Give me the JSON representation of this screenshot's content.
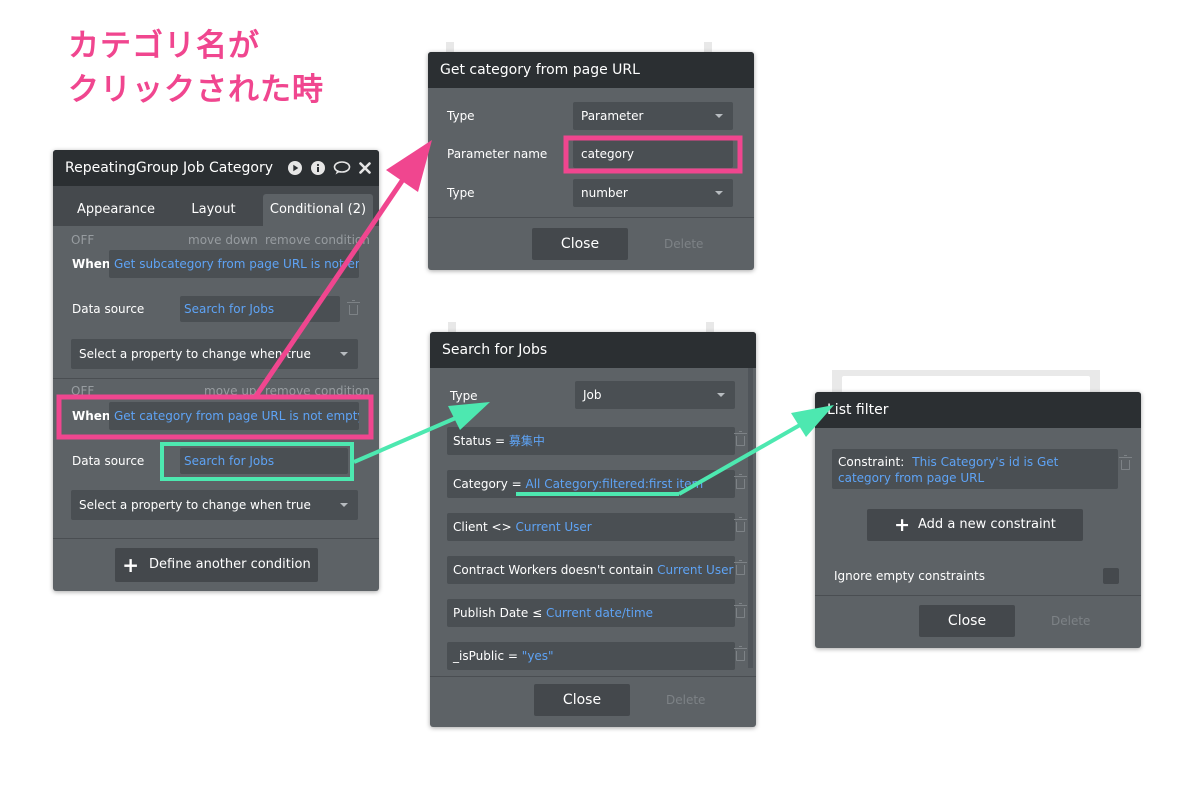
{
  "annotation": {
    "line1": "カテゴリ名が",
    "line2": "クリックされた時"
  },
  "panel_rg": {
    "title": "RepeatingGroup Job Category",
    "tabs": [
      "Appearance",
      "Layout",
      "Conditional (2)"
    ],
    "c1": {
      "off": "OFF",
      "move": "move down",
      "remove": "remove condition",
      "when_label": "When",
      "when_value": "Get subcategory from page URL is not empty",
      "ds_label": "Data source",
      "ds_value": "Search for Jobs",
      "select": "Select a property to change when true"
    },
    "c2": {
      "off": "OFF",
      "move": "move up",
      "remove": "remove condition",
      "when_label": "When",
      "when_value": "Get category from page URL is not empty",
      "ds_label": "Data source",
      "ds_value": "Search for Jobs",
      "select": "Select a property to change when true"
    },
    "define_button": "Define another condition"
  },
  "panel_url": {
    "title": "Get category from page URL",
    "rows": [
      {
        "label": "Type",
        "value": "Parameter"
      },
      {
        "label": "Parameter name",
        "value": "category"
      },
      {
        "label": "Type",
        "value": "number"
      }
    ],
    "close": "Close",
    "delete": "Delete"
  },
  "panel_search": {
    "title": "Search for Jobs",
    "type_label": "Type",
    "type_value": "Job",
    "constraints": [
      {
        "label": "Status = ",
        "value": "募集中"
      },
      {
        "label": "Category = ",
        "value": "All Category:filtered:first item"
      },
      {
        "label": "Client <> ",
        "value": "Current User"
      },
      {
        "label": "Contract Workers doesn't contain ",
        "value": "Current User"
      },
      {
        "label": "Publish Date ≤ ",
        "value": "Current date/time"
      },
      {
        "label": "_isPublic = ",
        "value": "\"yes\""
      }
    ],
    "close": "Close",
    "delete": "Delete"
  },
  "panel_filter": {
    "title": "List filter",
    "constraint_label": "Constraint:",
    "constraint_value": "This Category's id is Get category from page URL",
    "add_button": "Add a new constraint",
    "ignore_label": "Ignore empty constraints",
    "close": "Close",
    "delete": "Delete"
  },
  "colors": {
    "annotation_pink": "#f0468f",
    "highlight_green": "#4de8b0",
    "link_blue": "#5ea3f5",
    "panel_gray": "#5d6266",
    "titlebar_dark": "#2b2f32"
  },
  "icons": [
    "play-icon",
    "info-icon",
    "comment-icon",
    "close-icon",
    "trash-icon",
    "plus-icon",
    "chevron-down-icon"
  ]
}
